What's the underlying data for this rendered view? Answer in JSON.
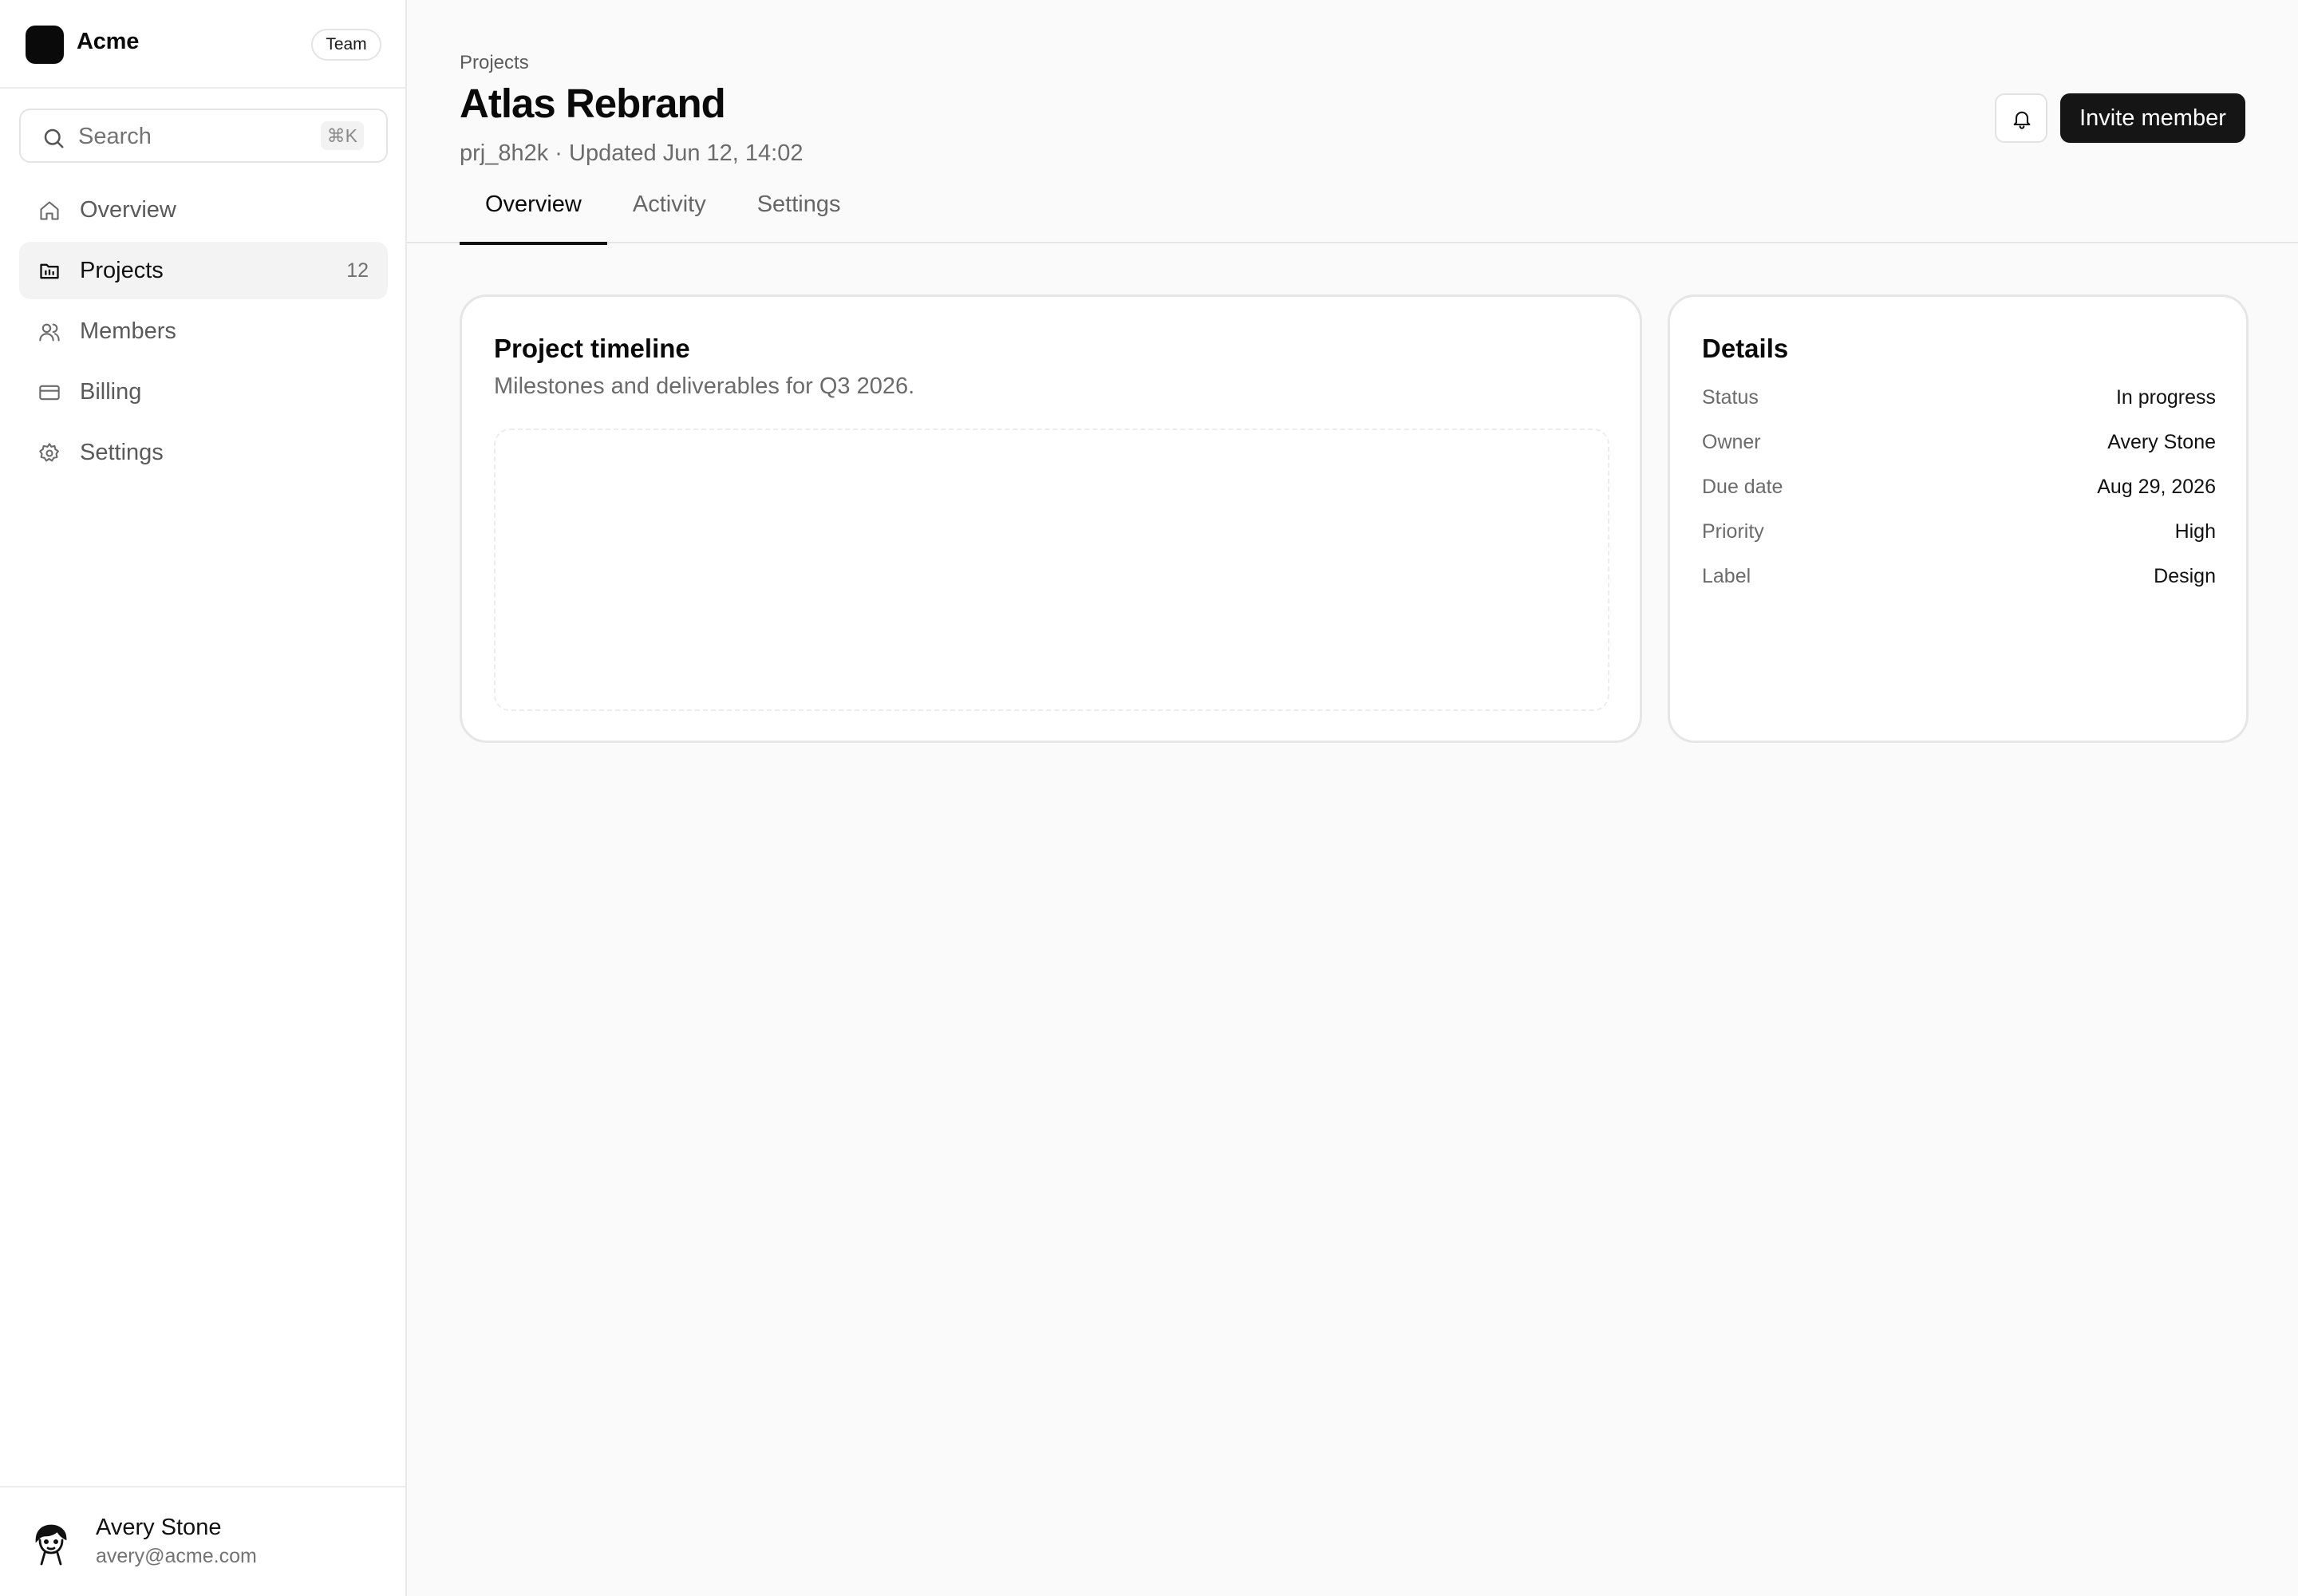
{
  "brand": {
    "name": "Acme",
    "badge": "Team"
  },
  "search": {
    "label": "Search",
    "shortcut": "⌘K"
  },
  "sidebar": {
    "items": [
      {
        "label": "Overview",
        "icon": "home-icon",
        "active": false,
        "count": ""
      },
      {
        "label": "Projects",
        "icon": "folder-icon",
        "active": true,
        "count": "12"
      },
      {
        "label": "Members",
        "icon": "users-icon",
        "active": false,
        "count": ""
      },
      {
        "label": "Billing",
        "icon": "credit-card-icon",
        "active": false,
        "count": ""
      },
      {
        "label": "Settings",
        "icon": "gear-icon",
        "active": false,
        "count": ""
      }
    ]
  },
  "user": {
    "name": "Avery Stone",
    "email": "avery@acme.com"
  },
  "header": {
    "breadcrumb": "Projects",
    "title": "Atlas Rebrand",
    "subtitle": "prj_8h2k · Updated Jun 12, 14:02",
    "invite_label": "Invite member",
    "tabs": [
      {
        "label": "Overview",
        "active": true
      },
      {
        "label": "Activity",
        "active": false
      },
      {
        "label": "Settings",
        "active": false
      }
    ]
  },
  "timeline_card": {
    "title": "Project timeline",
    "subtitle": "Milestones and deliverables for Q3 2026."
  },
  "details_card": {
    "title": "Details",
    "rows": [
      {
        "key": "Status",
        "value": "In progress"
      },
      {
        "key": "Owner",
        "value": "Avery Stone"
      },
      {
        "key": "Due date",
        "value": "Aug 29, 2026"
      },
      {
        "key": "Priority",
        "value": "High"
      },
      {
        "key": "Label",
        "value": "Design"
      }
    ]
  },
  "colors": {
    "primary": "#151515",
    "background": "#fafafa",
    "border": "#e6e6e6"
  }
}
